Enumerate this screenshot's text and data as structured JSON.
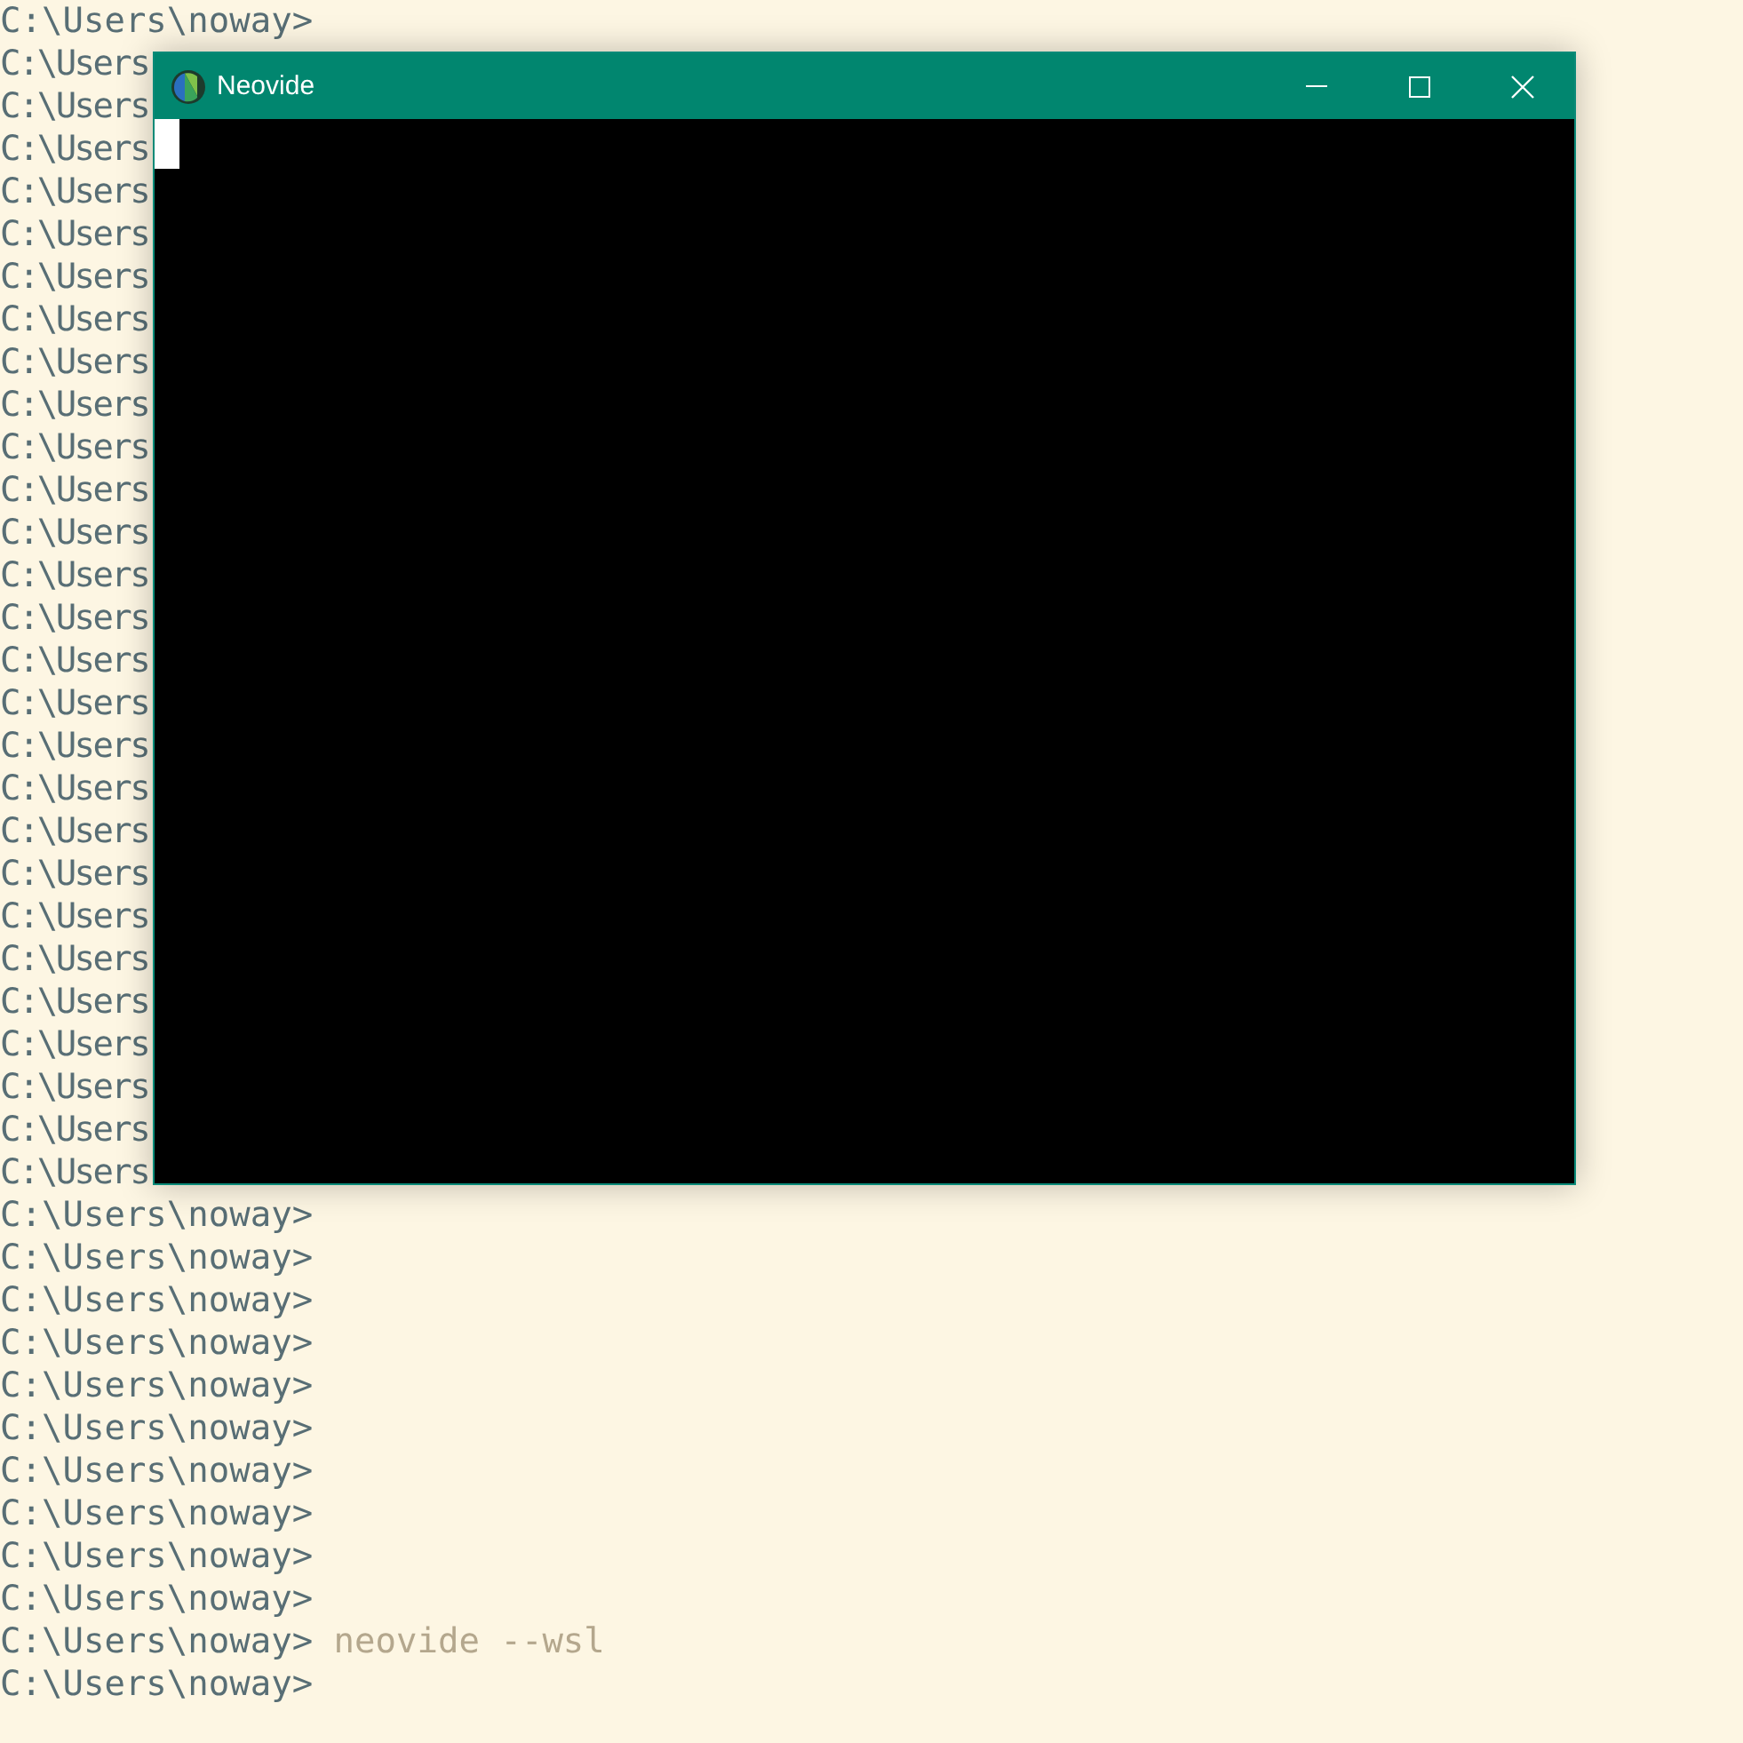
{
  "terminal": {
    "lines": [
      {
        "prompt": "C:\\Users\\noway>"
      },
      {
        "prompt": "C:\\Users",
        "kind": "covered"
      },
      {
        "prompt": "C:\\Users",
        "kind": "covered"
      },
      {
        "prompt": "C:\\Users",
        "kind": "covered"
      },
      {
        "prompt": "C:\\Users",
        "kind": "covered"
      },
      {
        "prompt": "C:\\Users",
        "kind": "covered"
      },
      {
        "prompt": "C:\\Users",
        "kind": "covered"
      },
      {
        "prompt": "C:\\Users",
        "kind": "covered"
      },
      {
        "prompt": "C:\\Users",
        "kind": "covered"
      },
      {
        "prompt": "C:\\Users",
        "kind": "covered"
      },
      {
        "prompt": "C:\\Users",
        "kind": "covered"
      },
      {
        "prompt": "C:\\Users",
        "kind": "covered"
      },
      {
        "prompt": "C:\\Users",
        "kind": "covered"
      },
      {
        "prompt": "C:\\Users",
        "kind": "covered"
      },
      {
        "prompt": "C:\\Users",
        "kind": "covered"
      },
      {
        "prompt": "C:\\Users",
        "kind": "covered"
      },
      {
        "prompt": "C:\\Users",
        "kind": "covered"
      },
      {
        "prompt": "C:\\Users",
        "kind": "covered"
      },
      {
        "prompt": "C:\\Users",
        "kind": "covered"
      },
      {
        "prompt": "C:\\Users",
        "kind": "covered"
      },
      {
        "prompt": "C:\\Users",
        "kind": "covered"
      },
      {
        "prompt": "C:\\Users",
        "kind": "covered"
      },
      {
        "prompt": "C:\\Users",
        "kind": "covered"
      },
      {
        "prompt": "C:\\Users",
        "kind": "covered"
      },
      {
        "prompt": "C:\\Users",
        "kind": "covered"
      },
      {
        "prompt": "C:\\Users",
        "kind": "covered"
      },
      {
        "prompt": "C:\\Users",
        "kind": "covered"
      },
      {
        "prompt": "C:\\Users",
        "kind": "covered"
      },
      {
        "prompt": "C:\\Users\\noway>"
      },
      {
        "prompt": "C:\\Users\\noway>"
      },
      {
        "prompt": "C:\\Users\\noway>"
      },
      {
        "prompt": "C:\\Users\\noway>"
      },
      {
        "prompt": "C:\\Users\\noway>"
      },
      {
        "prompt": "C:\\Users\\noway>"
      },
      {
        "prompt": "C:\\Users\\noway>"
      },
      {
        "prompt": "C:\\Users\\noway>"
      },
      {
        "prompt": "C:\\Users\\noway>"
      },
      {
        "prompt": "C:\\Users\\noway>"
      },
      {
        "prompt": "C:\\Users\\noway>",
        "command": "neovide --wsl"
      },
      {
        "prompt": "C:\\Users\\noway>"
      }
    ]
  },
  "window": {
    "title": "Neovide"
  }
}
